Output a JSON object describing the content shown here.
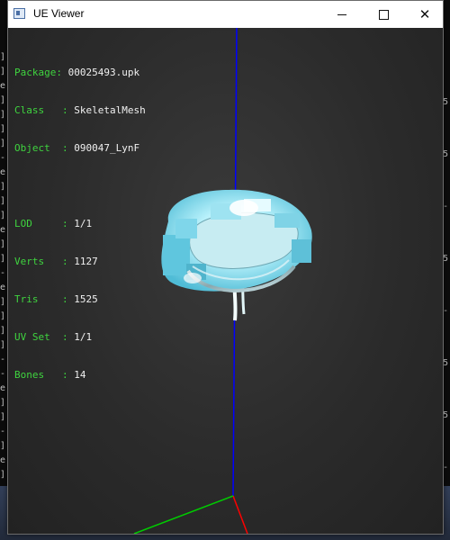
{
  "window": {
    "title": "UE Viewer",
    "minimize_label": "Minimize",
    "maximize_label": "Maximize",
    "close_label": "Close",
    "close_glyph": "✕"
  },
  "info": {
    "package": {
      "key": "Package: ",
      "value": "00025493.upk"
    },
    "class": {
      "key": "Class   : ",
      "value": "SkeletalMesh"
    },
    "object": {
      "key": "Object  : ",
      "value": "090047_LynF"
    },
    "lod": {
      "key": "LOD     : ",
      "value": "1/1"
    },
    "verts": {
      "key": "Verts   : ",
      "value": "1127"
    },
    "tris": {
      "key": "Tris    : ",
      "value": "1525"
    },
    "uvset": {
      "key": "UV Set  : ",
      "value": "1/1"
    },
    "bones": {
      "key": "Bones   : ",
      "value": "14"
    }
  },
  "colors": {
    "info_key": "#3fd43f",
    "info_value": "#f0f0f0",
    "axis_x": "#ff0000",
    "axis_y": "#00cc00",
    "axis_z": "#0000ff",
    "mesh_tint": "#8fe4f4"
  },
  "background_console": {
    "left_glyphs": [
      "]",
      "]",
      "e",
      "]",
      "]",
      "]",
      "]",
      "-",
      "e",
      "]",
      "]",
      "]",
      "e",
      "]",
      "]",
      "-",
      "e",
      "]",
      "]",
      "]",
      "]",
      "-",
      "-",
      "e",
      "]",
      "]",
      "-",
      "]",
      "e",
      "]"
    ],
    "right_glyphs": [
      "5",
      "5",
      "-",
      "5",
      "-",
      "5",
      "5",
      "-"
    ]
  }
}
